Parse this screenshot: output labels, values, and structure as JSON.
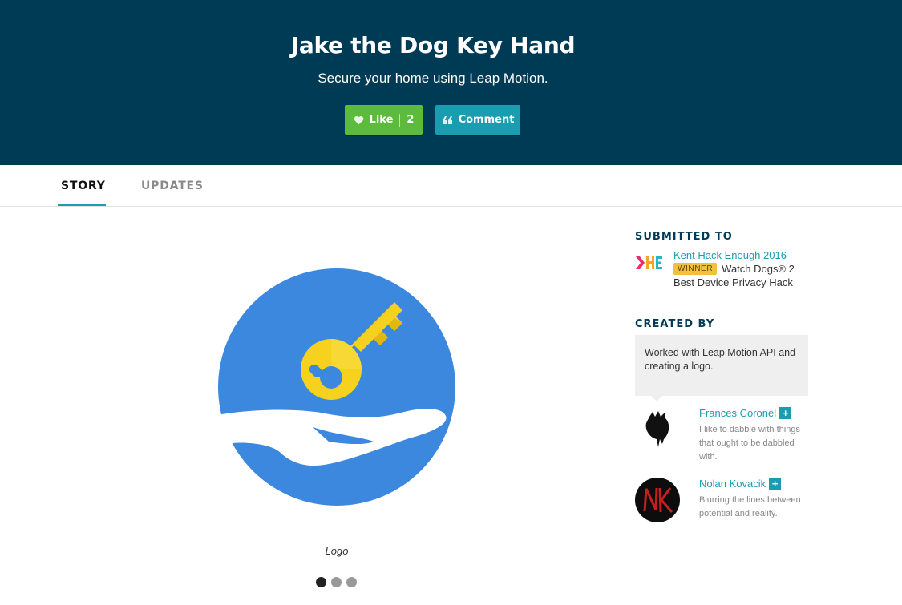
{
  "hero": {
    "title": "Jake the Dog Key Hand",
    "subtitle": "Secure your home using Leap Motion.",
    "like_label": "Like",
    "like_count": "2",
    "comment_label": "Comment"
  },
  "tabs": [
    {
      "label": "STORY",
      "active": true
    },
    {
      "label": "UPDATES",
      "active": false
    }
  ],
  "media": {
    "caption": "Logo",
    "slide_count": 3,
    "active_slide": 1
  },
  "sidebar": {
    "submitted_heading": "SUBMITTED TO",
    "hackathon": {
      "name": "Kent Hack Enough 2016",
      "badge": "WINNER",
      "prize_line1": "Watch Dogs® 2",
      "prize_line2": "Best Device Privacy Hack"
    },
    "created_heading": "CREATED BY",
    "contribution": "Worked with Leap Motion API and creating a logo.",
    "members": [
      {
        "name": "Frances Coronel",
        "bio": "I like to dabble with things that ought to be dabbled with."
      },
      {
        "name": "Nolan Kovacik",
        "bio": "Blurring the lines between potential and reality."
      }
    ]
  },
  "colors": {
    "hero_bg": "#003b55",
    "like_green": "#5dbb3c",
    "accent_teal": "#1a9cb1",
    "logo_blue": "#3b88de",
    "key_yellow": "#f6d21f"
  }
}
